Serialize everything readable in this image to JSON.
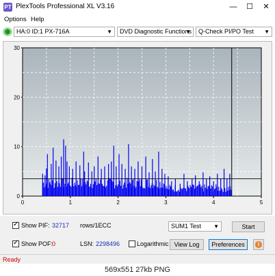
{
  "window": {
    "title": "PlexTools Professional XL V3.16",
    "icon_label": "PT"
  },
  "menu": {
    "items": [
      "Options",
      "Help"
    ]
  },
  "toolbar": {
    "drive": "HA:0 ID:1  PX-716A",
    "function": "DVD Diagnostic Functions",
    "test": "Q-Check PI/PO Test"
  },
  "chart_data": {
    "type": "bar",
    "x_ticks": [
      "0",
      "1",
      "2",
      "3",
      "4",
      "5"
    ],
    "y_ticks": [
      "0",
      "10",
      "20",
      "30"
    ],
    "xlim": [
      0,
      5
    ],
    "ylim": [
      0,
      30
    ],
    "threshold_line": 3.5,
    "end_marker_x": 4.38,
    "grid": true,
    "bar_color": "#0000ee",
    "bg_top_color": "#aab4bc",
    "bg_bottom_color": "#e8ecec",
    "peaks": [
      {
        "x": 0.42,
        "y": 4.5
      },
      {
        "x": 0.47,
        "y": 4.2
      },
      {
        "x": 0.5,
        "y": 5.6
      },
      {
        "x": 0.52,
        "y": 8.5
      },
      {
        "x": 0.6,
        "y": 6.5
      },
      {
        "x": 0.64,
        "y": 9.8
      },
      {
        "x": 0.7,
        "y": 7.2
      },
      {
        "x": 0.76,
        "y": 6.0
      },
      {
        "x": 0.81,
        "y": 8.0
      },
      {
        "x": 0.86,
        "y": 11.5
      },
      {
        "x": 0.9,
        "y": 10.2
      },
      {
        "x": 0.93,
        "y": 7.0
      },
      {
        "x": 0.98,
        "y": 6.0
      },
      {
        "x": 1.05,
        "y": 5.5
      },
      {
        "x": 1.12,
        "y": 7.0
      },
      {
        "x": 1.2,
        "y": 6.2
      },
      {
        "x": 1.28,
        "y": 9.0
      },
      {
        "x": 1.3,
        "y": 5.0
      },
      {
        "x": 1.38,
        "y": 6.8
      },
      {
        "x": 1.45,
        "y": 5.0
      },
      {
        "x": 1.5,
        "y": 6.0
      },
      {
        "x": 1.58,
        "y": 8.0
      },
      {
        "x": 1.65,
        "y": 5.5
      },
      {
        "x": 1.72,
        "y": 6.0
      },
      {
        "x": 1.8,
        "y": 6.5
      },
      {
        "x": 1.86,
        "y": 7.0
      },
      {
        "x": 1.91,
        "y": 10.2
      },
      {
        "x": 1.96,
        "y": 6.0
      },
      {
        "x": 2.02,
        "y": 8.5
      },
      {
        "x": 2.08,
        "y": 6.5
      },
      {
        "x": 2.15,
        "y": 5.5
      },
      {
        "x": 2.22,
        "y": 10.5
      },
      {
        "x": 2.28,
        "y": 6.0
      },
      {
        "x": 2.35,
        "y": 5.5
      },
      {
        "x": 2.42,
        "y": 7.0
      },
      {
        "x": 2.5,
        "y": 6.0
      },
      {
        "x": 2.58,
        "y": 8.0
      },
      {
        "x": 2.65,
        "y": 4.8
      },
      {
        "x": 2.72,
        "y": 7.5
      },
      {
        "x": 2.78,
        "y": 5.0
      },
      {
        "x": 2.85,
        "y": 9.0
      },
      {
        "x": 2.92,
        "y": 5.5
      },
      {
        "x": 2.98,
        "y": 4.5
      },
      {
        "x": 3.05,
        "y": 4.0
      },
      {
        "x": 3.12,
        "y": 3.0
      },
      {
        "x": 3.2,
        "y": 3.5
      },
      {
        "x": 3.3,
        "y": 2.5
      },
      {
        "x": 3.38,
        "y": 4.5
      },
      {
        "x": 3.45,
        "y": 3.0
      },
      {
        "x": 3.55,
        "y": 3.5
      },
      {
        "x": 3.62,
        "y": 4.2
      },
      {
        "x": 3.7,
        "y": 3.0
      },
      {
        "x": 3.78,
        "y": 4.8
      },
      {
        "x": 3.85,
        "y": 3.5
      },
      {
        "x": 3.92,
        "y": 4.0
      },
      {
        "x": 4.0,
        "y": 3.0
      },
      {
        "x": 4.08,
        "y": 4.5
      },
      {
        "x": 4.15,
        "y": 3.5
      },
      {
        "x": 4.22,
        "y": 5.5
      },
      {
        "x": 4.28,
        "y": 3.5
      },
      {
        "x": 4.34,
        "y": 4.5
      }
    ]
  },
  "panel": {
    "show_pif_label": "Show PIF:",
    "pif_value": "32717",
    "pif_unit": "rows/1ECC",
    "show_pof_label": "Show POF:",
    "pof_value": "0",
    "lsn_label": "LSN:",
    "lsn_value": "2298496",
    "logarithmic_label": "Logarithmic",
    "sum_select": "SUM1 Test",
    "start_label": "Start",
    "view_log_label": "View Log",
    "preferences_label": "Preferences"
  },
  "status": {
    "text": "Ready"
  },
  "caption": {
    "text": "569x551  27kb  PNG"
  }
}
